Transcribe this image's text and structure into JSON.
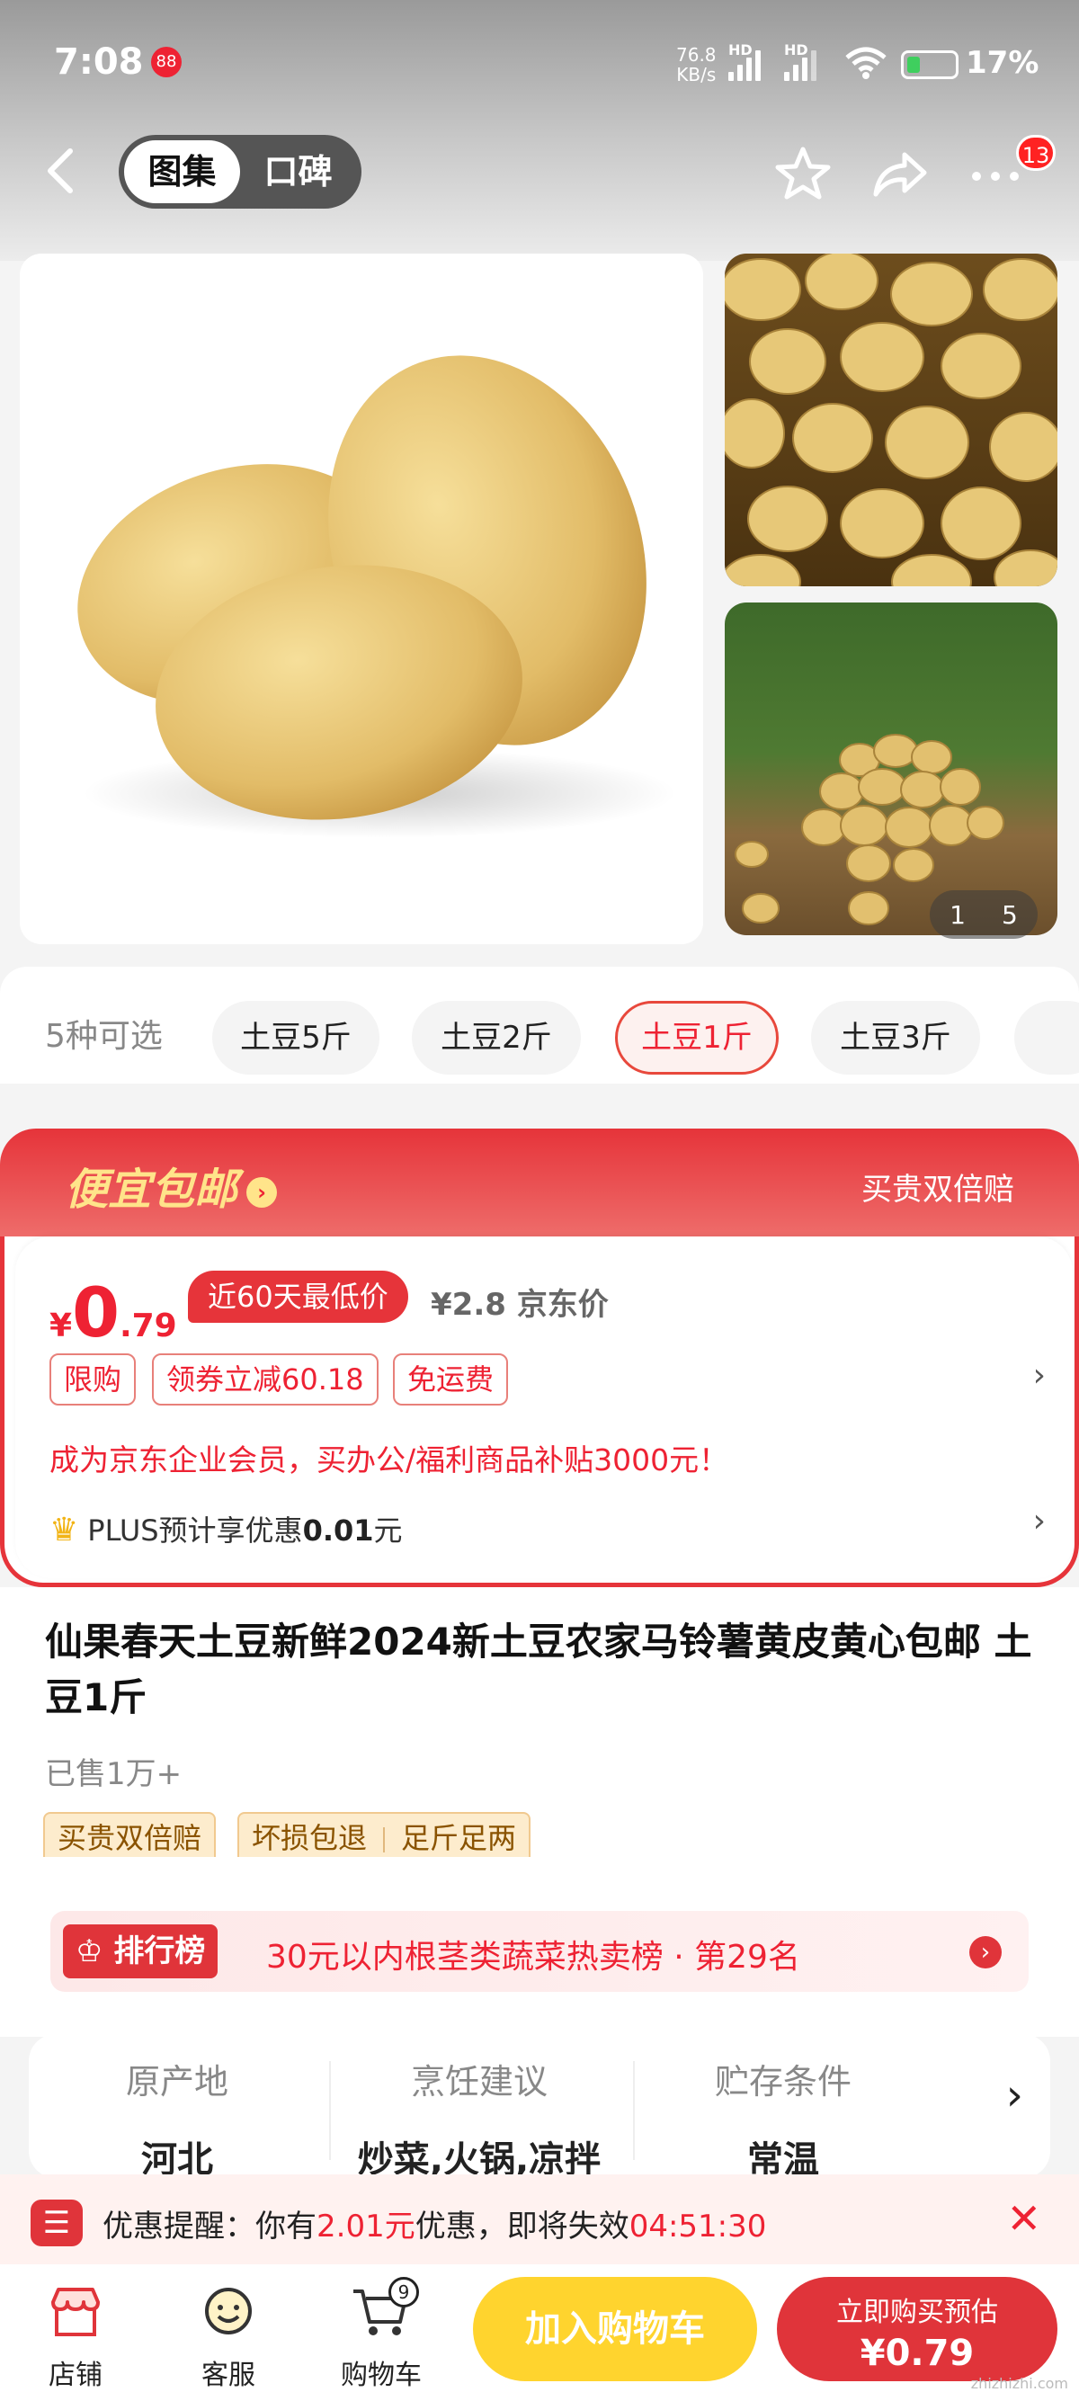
{
  "status_bar": {
    "time": "7:08",
    "notification_badge": "88",
    "net_speed": "76.8",
    "net_unit": "KB/s",
    "sig1_label": "HD",
    "sig2_label": "HD",
    "battery": "17%",
    "battery_color": "#3fcf5e"
  },
  "header": {
    "tabs": [
      "图集",
      "口碑"
    ],
    "active_tab": "图集",
    "more_badge": "13",
    "icons": [
      "back-icon",
      "star-icon",
      "share-icon",
      "more-icon"
    ]
  },
  "gallery": {
    "counter_current": "1",
    "counter_total": "5"
  },
  "variants": {
    "count_label": "5种可选",
    "options": [
      "土豆5斤",
      "土豆2斤",
      "土豆1斤",
      "土豆3斤"
    ],
    "selected": "土豆1斤"
  },
  "promo": {
    "title": "便宜包邮",
    "guarantee": "买贵双倍赔",
    "currency": "¥",
    "price_int": "0",
    "price_dec": ".79",
    "low_badge": "近60天最低价",
    "jd_price": "¥2.8 京东价",
    "tags": [
      "限购",
      "领券立减60.18",
      "免运费"
    ],
    "biz_text": "成为京东企业会员，买办公/福利商品补贴3000元！",
    "plus_prefix": "PLUS预计享优惠",
    "plus_value": "0.01",
    "plus_suffix": "元",
    "accent_color": "#e6343a"
  },
  "product": {
    "title": "仙果春天土豆新鲜2024新土豆农家马铃薯黄皮黄心包邮 土豆1斤",
    "sold": "已售1万+",
    "service_tag_1": "买贵双倍赔",
    "service_tag_2a": "坏损包退",
    "service_tag_2b": "足斤足两"
  },
  "ranking": {
    "badge": "排行榜",
    "text": "30元以内根茎类蔬菜热卖榜 · 第29名"
  },
  "attributes": [
    {
      "key": "原产地",
      "value": "河北"
    },
    {
      "key": "烹饪建议",
      "value": "炒菜,火锅,凉拌"
    },
    {
      "key": "贮存条件",
      "value": "常温"
    }
  ],
  "reminder": {
    "prefix": "优惠提醒：你有",
    "amount": "2.01元",
    "middle": "优惠，即将失效",
    "countdown": "04:51:30"
  },
  "bottom_bar": {
    "nav": [
      {
        "label": "店铺",
        "icon": "shop-icon"
      },
      {
        "label": "客服",
        "icon": "service-icon"
      },
      {
        "label": "购物车",
        "icon": "cart-icon"
      }
    ],
    "cart_count": "9",
    "add_to_cart": "加入购物车",
    "buy_line1": "立即购买预估",
    "buy_line2": "¥0.79"
  },
  "watermark": "zhizhizhi.com"
}
